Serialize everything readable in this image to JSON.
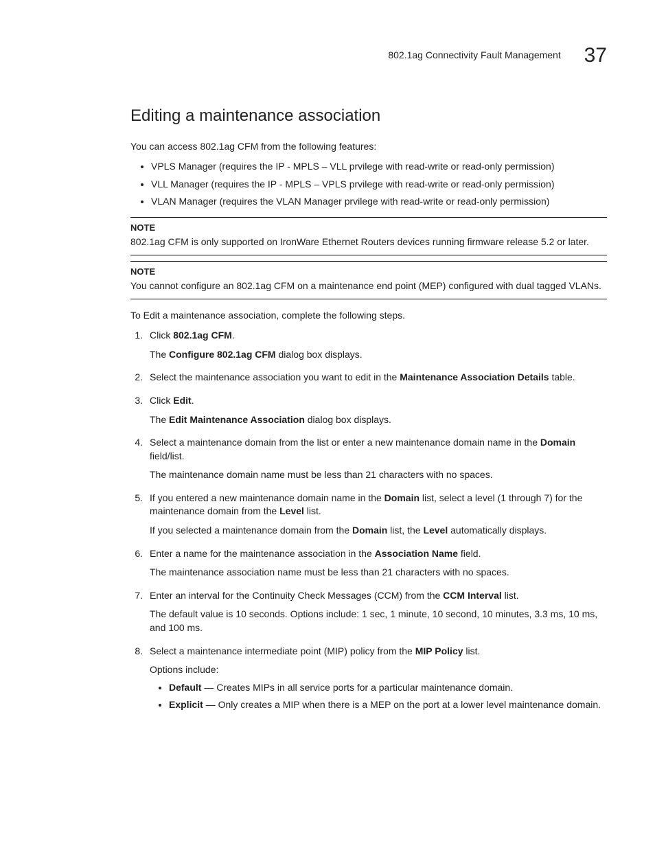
{
  "header": {
    "title": "802.1ag Connectivity Fault Management",
    "chapter_num": "37"
  },
  "section": {
    "heading": "Editing a maintenance association",
    "intro": "You can access 802.1ag CFM from the following features:",
    "intro_bullets": [
      "VPLS Manager (requires the IP - MPLS – VLL prvilege with read-write or read-only permission)",
      "VLL Manager (requires the IP - MPLS – VPLS prvilege with read-write or read-only permission)",
      "VLAN Manager (requires the VLAN Manager prvilege with read-write or read-only permission)"
    ],
    "notes": [
      {
        "label": "NOTE",
        "text": "802.1ag CFM is only supported on IronWare Ethernet Routers devices running firmware release 5.2 or later."
      },
      {
        "label": "NOTE",
        "text": "You cannot configure an 802.1ag CFM on a maintenance end point (MEP) configured with dual tagged VLANs."
      }
    ],
    "lead_in": "To Edit a maintenance association, complete the following steps.",
    "steps": {
      "s1_a": "Click ",
      "s1_b": "802.1ag CFM",
      "s1_c": ".",
      "s1_p_a": "The ",
      "s1_p_b": "Configure 802.1ag CFM",
      "s1_p_c": " dialog box displays.",
      "s2_a": "Select the maintenance association you want to edit in the ",
      "s2_b": "Maintenance Association Details",
      "s2_c": " table.",
      "s3_a": "Click ",
      "s3_b": "Edit",
      "s3_c": ".",
      "s3_p_a": "The ",
      "s3_p_b": "Edit Maintenance Association",
      "s3_p_c": " dialog box displays.",
      "s4_a": "Select a maintenance domain from the list or enter a new maintenance domain name in the ",
      "s4_b": "Domain",
      "s4_c": " field/list.",
      "s4_p": "The maintenance domain name must be less than 21 characters with no spaces.",
      "s5_a": "If you entered a new maintenance domain name in the ",
      "s5_b": "Domain",
      "s5_c": " list, select a level (1 through 7) for the maintenance domain from the ",
      "s5_d": "Level",
      "s5_e": " list.",
      "s5_p_a": "If you selected a maintenance domain from the ",
      "s5_p_b": "Domain",
      "s5_p_c": " list, the ",
      "s5_p_d": "Level",
      "s5_p_e": " automatically displays.",
      "s6_a": "Enter a name for the maintenance association in the ",
      "s6_b": "Association Name",
      "s6_c": " field.",
      "s6_p": "The maintenance association name must be less than 21 characters with no spaces.",
      "s7_a": "Enter an interval for the Continuity Check Messages (CCM) from the ",
      "s7_b": "CCM Interval",
      "s7_c": " list.",
      "s7_p": "The default value is 10 seconds. Options include: 1 sec, 1 minute, 10 second, 10 minutes, 3.3 ms, 10 ms, and 100 ms.",
      "s8_a": "Select a maintenance intermediate point (MIP) policy from the ",
      "s8_b": "MIP Policy",
      "s8_c": " list.",
      "s8_p": "Options include:",
      "s8_opt1_b": "Default",
      "s8_opt1_t": " — Creates MIPs in all service ports for a particular maintenance domain.",
      "s8_opt2_b": "Explicit",
      "s8_opt2_t": " — Only creates a MIP when there is a MEP on the port at a lower level maintenance domain."
    }
  }
}
